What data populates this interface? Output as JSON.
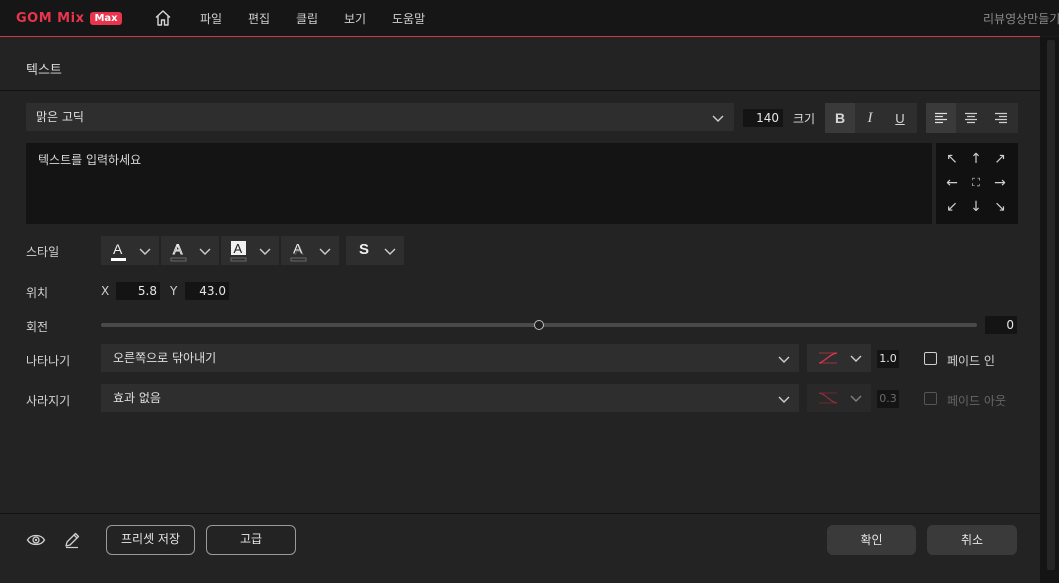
{
  "app": {
    "logo_text": "GOM Mix",
    "logo_badge": "Max",
    "menu": [
      "파일",
      "편집",
      "클립",
      "보기",
      "도움말"
    ],
    "project_title": "리뷰영상만들기"
  },
  "dialog": {
    "title": "텍스트",
    "font": {
      "selected": "맑은 고딕"
    },
    "size": {
      "value": "140",
      "label": "크기"
    },
    "format_buttons": [
      "B",
      "I",
      "U"
    ],
    "align": {
      "active": "left"
    },
    "text_input": {
      "placeholder": "텍스트를 입력하세요"
    },
    "position_arrows": [
      "↖",
      "↑",
      "↗",
      "←",
      "⛶",
      "→",
      "↙",
      "↓",
      "↘"
    ],
    "style": {
      "label": "스타일",
      "text_s": "S"
    },
    "position": {
      "label": "위치",
      "x_label": "X",
      "x_value": "5.8",
      "y_label": "Y",
      "y_value": "43.0"
    },
    "rotation": {
      "label": "회전",
      "value": "0",
      "slider_fraction": 0.5
    },
    "appear": {
      "label": "나타나기",
      "effect": "오른쪽으로 닦아내기",
      "duration": "1.0",
      "fade_label": "페이드 인"
    },
    "disappear": {
      "label": "사라지기",
      "effect": "효과 없음",
      "duration": "0.3",
      "fade_label": "페이드 아웃"
    },
    "footer": {
      "preset_save": "프리셋 저장",
      "advanced": "고급",
      "ok": "확인",
      "cancel": "취소"
    }
  },
  "colors": {
    "accent": "#e8354d",
    "panel": "#232323",
    "field": "#141414"
  }
}
